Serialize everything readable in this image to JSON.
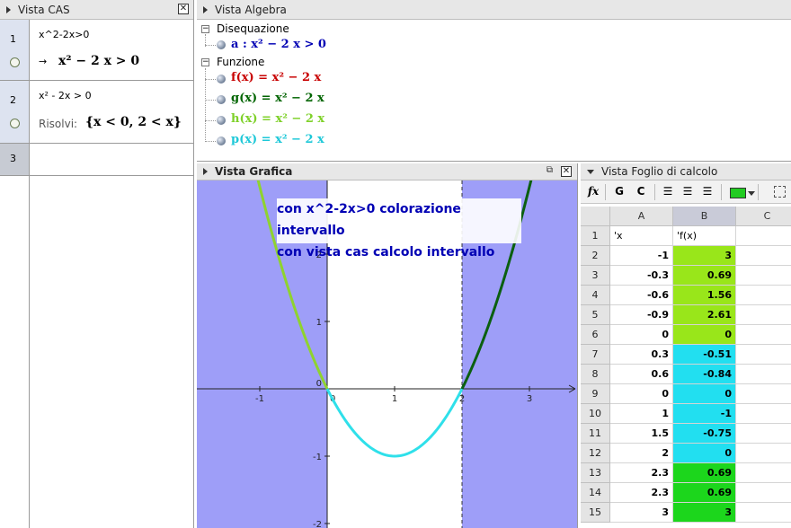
{
  "cas": {
    "title": "Vista CAS",
    "close_glyph": "✕",
    "rows": [
      {
        "num": "1",
        "input": "x^2-2x>0",
        "arrow": "→",
        "output": "x² − 2 x > 0"
      },
      {
        "num": "2",
        "input": "x² - 2x > 0",
        "label": "Risolvi:",
        "output": "{x < 0, 2 < x}"
      },
      {
        "num": "3"
      }
    ]
  },
  "algebra": {
    "title": "Vista Algebra",
    "categories": [
      {
        "name": "Disequazione",
        "items": [
          {
            "text": "a : x² − 2 x > 0",
            "color": "#0000b4"
          }
        ]
      },
      {
        "name": "Funzione",
        "items": [
          {
            "text": "f(x) = x² − 2 x",
            "color": "#c80000"
          },
          {
            "text": "g(x) = x² − 2 x",
            "color": "#006400"
          },
          {
            "text": "h(x) = x² − 2 x",
            "color": "#7fd12a"
          },
          {
            "text": "p(x) = x² − 2 x",
            "color": "#1ec8d8"
          }
        ]
      }
    ]
  },
  "graphics": {
    "title": "Vista Grafica",
    "dock_glyph": "⧉",
    "close_glyph": "✕",
    "annotation_line1": "con x^2-2x>0 colorazione intervallo",
    "annotation_line2": "con vista cas calcolo intervallo",
    "x_ticks": [
      "-1",
      "0",
      "1",
      "2",
      "3"
    ],
    "y_ticks": [
      "2",
      "1",
      "0",
      "-1",
      "-2"
    ],
    "colors": {
      "shade": "#9e9ef8",
      "left_branch": "#8fd32f",
      "bottom": "#2fe0ea",
      "right_branch": "#0b5f10",
      "annotation": "#0000b4"
    }
  },
  "spreadsheet": {
    "title": "Vista Foglio di calcolo",
    "toolbar": {
      "fx": "fx",
      "bold": "G",
      "italic": "C",
      "fill_color": "#22cc22"
    },
    "columns": [
      "A",
      "B",
      "C"
    ],
    "rows": [
      {
        "n": "1",
        "a": "'x",
        "b": "'f(x)",
        "color": ""
      },
      {
        "n": "2",
        "a": "-1",
        "b": "3",
        "color": "#99e61a"
      },
      {
        "n": "3",
        "a": "-0.3",
        "b": "0.69",
        "color": "#99e61a"
      },
      {
        "n": "4",
        "a": "-0.6",
        "b": "1.56",
        "color": "#99e61a"
      },
      {
        "n": "5",
        "a": "-0.9",
        "b": "2.61",
        "color": "#99e61a"
      },
      {
        "n": "6",
        "a": "0",
        "b": "0",
        "color": "#99e61a"
      },
      {
        "n": "7",
        "a": "0.3",
        "b": "-0.51",
        "color": "#22dff0"
      },
      {
        "n": "8",
        "a": "0.6",
        "b": "-0.84",
        "color": "#22dff0"
      },
      {
        "n": "9",
        "a": "0",
        "b": "0",
        "color": "#22dff0"
      },
      {
        "n": "10",
        "a": "1",
        "b": "-1",
        "color": "#22dff0"
      },
      {
        "n": "11",
        "a": "1.5",
        "b": "-0.75",
        "color": "#22dff0"
      },
      {
        "n": "12",
        "a": "2",
        "b": "0",
        "color": "#22dff0"
      },
      {
        "n": "13",
        "a": "2.3",
        "b": "0.69",
        "color": "#1cd61c"
      },
      {
        "n": "14",
        "a": "2.3",
        "b": "0.69",
        "color": "#1cd61c"
      },
      {
        "n": "15",
        "a": "3",
        "b": "3",
        "color": "#1cd61c"
      }
    ]
  }
}
